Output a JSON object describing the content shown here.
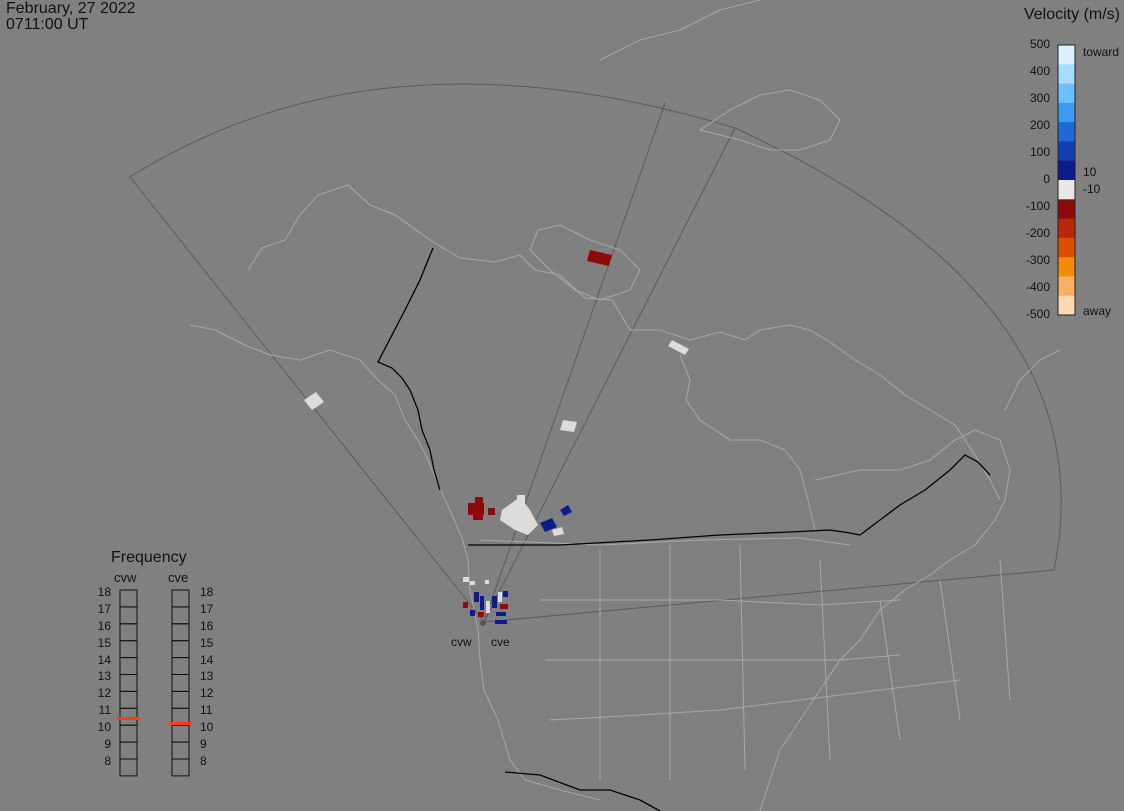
{
  "header": {
    "date": "February, 27 2022",
    "time": "0711:00 UT"
  },
  "legend": {
    "title": "Velocity (m/s)",
    "ticks": [
      "500",
      "400",
      "300",
      "200",
      "100",
      "0",
      "-100",
      "-200",
      "-300",
      "-400",
      "-500"
    ],
    "zero_marks": {
      "upper": "10",
      "lower": "-10"
    },
    "toward_label": "toward",
    "away_label": "away",
    "colors": [
      "#d8f0ff",
      "#a8dcff",
      "#6cc0ff",
      "#3a9cf0",
      "#2068d8",
      "#1040b0",
      "#0c1c8c",
      "#e8e8e8",
      "#8c0a0a",
      "#b82808",
      "#dc5006",
      "#f48a0a",
      "#f8b060",
      "#fcd8b0"
    ]
  },
  "frequency": {
    "title": "Frequency",
    "radars": [
      {
        "name": "cvw",
        "current_mhz": 10.9
      },
      {
        "name": "cve",
        "current_mhz": 10.6
      }
    ],
    "scale": [
      "18",
      "17",
      "16",
      "15",
      "14",
      "13",
      "12",
      "11",
      "10",
      "9",
      "8"
    ],
    "marker_color": "#ff3c14"
  },
  "sites": [
    {
      "name": "cvw"
    },
    {
      "name": "cve"
    }
  ],
  "colors": {
    "background": "#808080",
    "coast": "#a8a8a8",
    "border": "#000000",
    "fov": "#5a5a5a"
  }
}
